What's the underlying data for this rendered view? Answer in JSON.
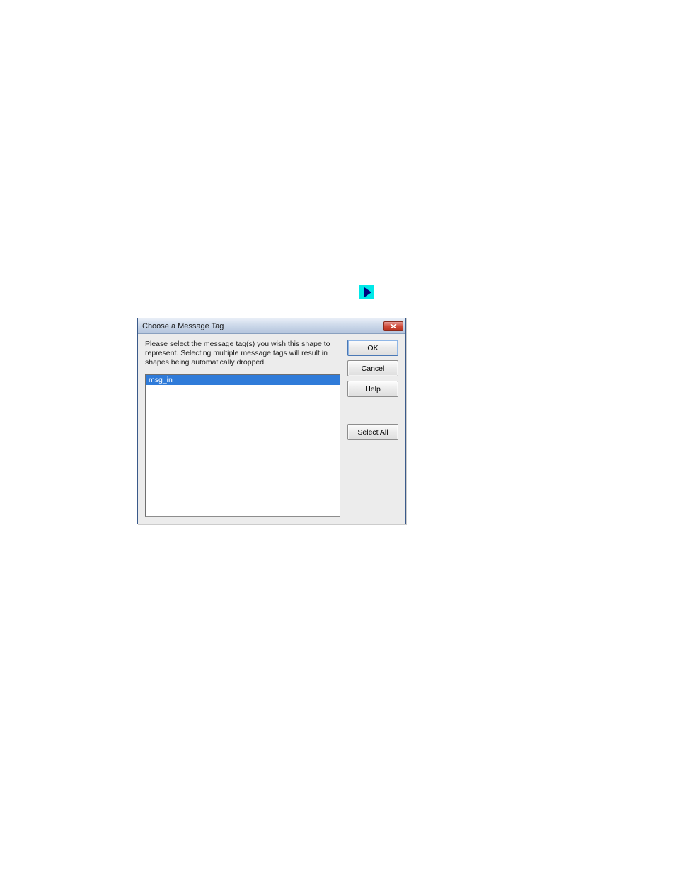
{
  "icon": {
    "name": "play-icon"
  },
  "dialog": {
    "title": "Choose a Message Tag",
    "instruction": "Please select the message tag(s) you wish this shape to represent.  Selecting multiple message tags will result in shapes being automatically dropped.",
    "list": {
      "items": [
        "msg_in"
      ],
      "selected": 0
    },
    "buttons": {
      "ok": "OK",
      "cancel": "Cancel",
      "help": "Help",
      "select_all": "Select All"
    }
  }
}
